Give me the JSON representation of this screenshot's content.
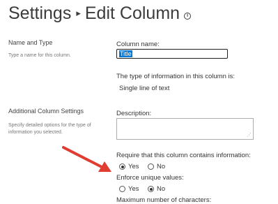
{
  "header": {
    "breadcrumb_root": "Settings",
    "separator": "▸",
    "page_title": "Edit Column",
    "info_glyph": "i"
  },
  "name_type_section": {
    "title": "Name and Type",
    "description": "Type a name for this column.",
    "column_name_label": "Column name:",
    "column_name_value": "Title",
    "type_info_label": "The type of information in this column is:",
    "type_value": "Single line of text"
  },
  "additional_section": {
    "title": "Additional Column Settings",
    "description": "Specify detailed options for the type of information you selected.",
    "description_label": "Description:",
    "description_value": "",
    "resize_glyph": "⋰",
    "require_label": "Require that this column contains information:",
    "require_options": [
      {
        "label": "Yes",
        "checked": true
      },
      {
        "label": "No",
        "checked": false
      }
    ],
    "unique_label": "Enforce unique values:",
    "unique_options": [
      {
        "label": "Yes",
        "checked": false
      },
      {
        "label": "No",
        "checked": true
      }
    ],
    "max_chars_label": "Maximum number of characters:"
  },
  "annotation": {
    "arrow_color": "#e03c31"
  },
  "colors": {
    "selection": "#0078d7",
    "text": "#333333"
  }
}
